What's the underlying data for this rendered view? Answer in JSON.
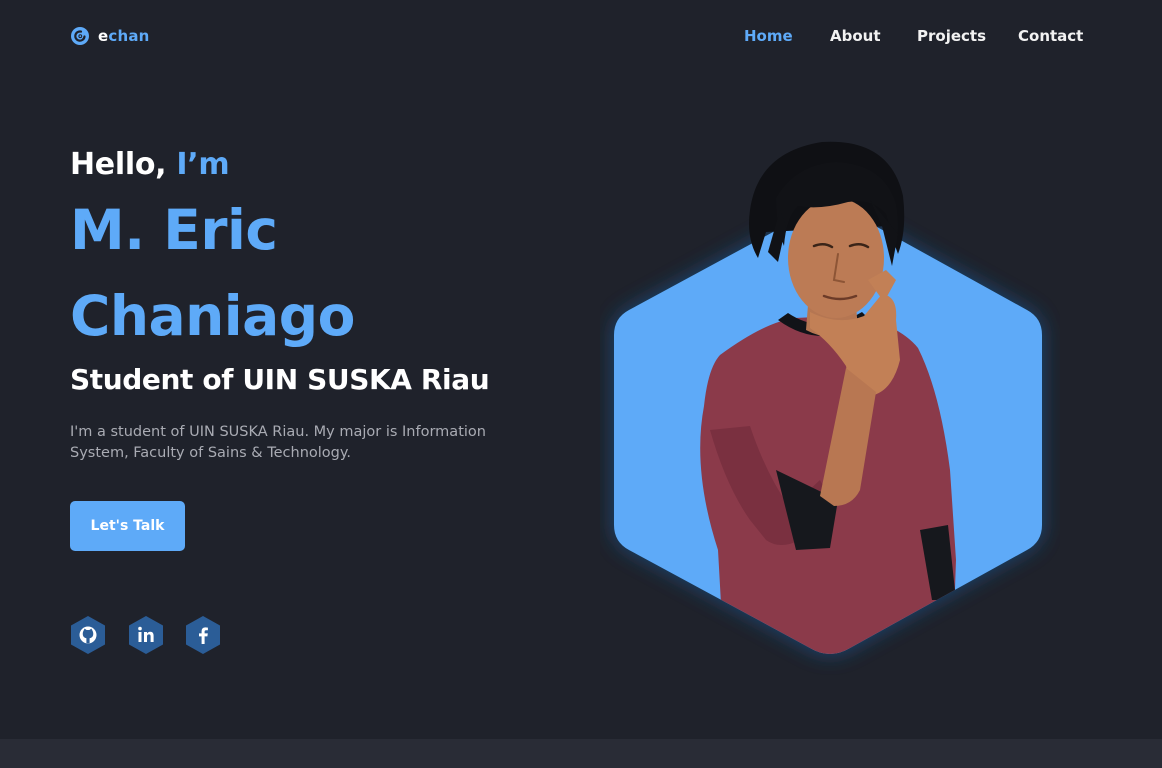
{
  "brand": {
    "logo_first_letter": "e",
    "logo_rest": "chan",
    "accent_color": "#5eaaf8",
    "background_color": "#1f222b"
  },
  "nav": {
    "items": [
      {
        "label": "Home",
        "active": true
      },
      {
        "label": "About",
        "active": false
      },
      {
        "label": "Projects",
        "active": false
      },
      {
        "label": "Contact",
        "active": false
      }
    ]
  },
  "hero": {
    "greeting_prefix": "Hello,",
    "greeting_accent": "I’m",
    "name_line_1": "M. Eric",
    "name_line_2": "Chaniago",
    "role": "Student of UIN SUSKA Riau",
    "description": "I'm a student of UIN SUSKA Riau. My major is Information System, Faculty of Sains & Technology.",
    "cta_label": "Let's Talk",
    "social_links": [
      {
        "icon": "github-icon"
      },
      {
        "icon": "linkedin-icon"
      },
      {
        "icon": "facebook-icon"
      }
    ],
    "portrait": {
      "shape": "hexagon",
      "color": "#5eaaf8"
    }
  }
}
